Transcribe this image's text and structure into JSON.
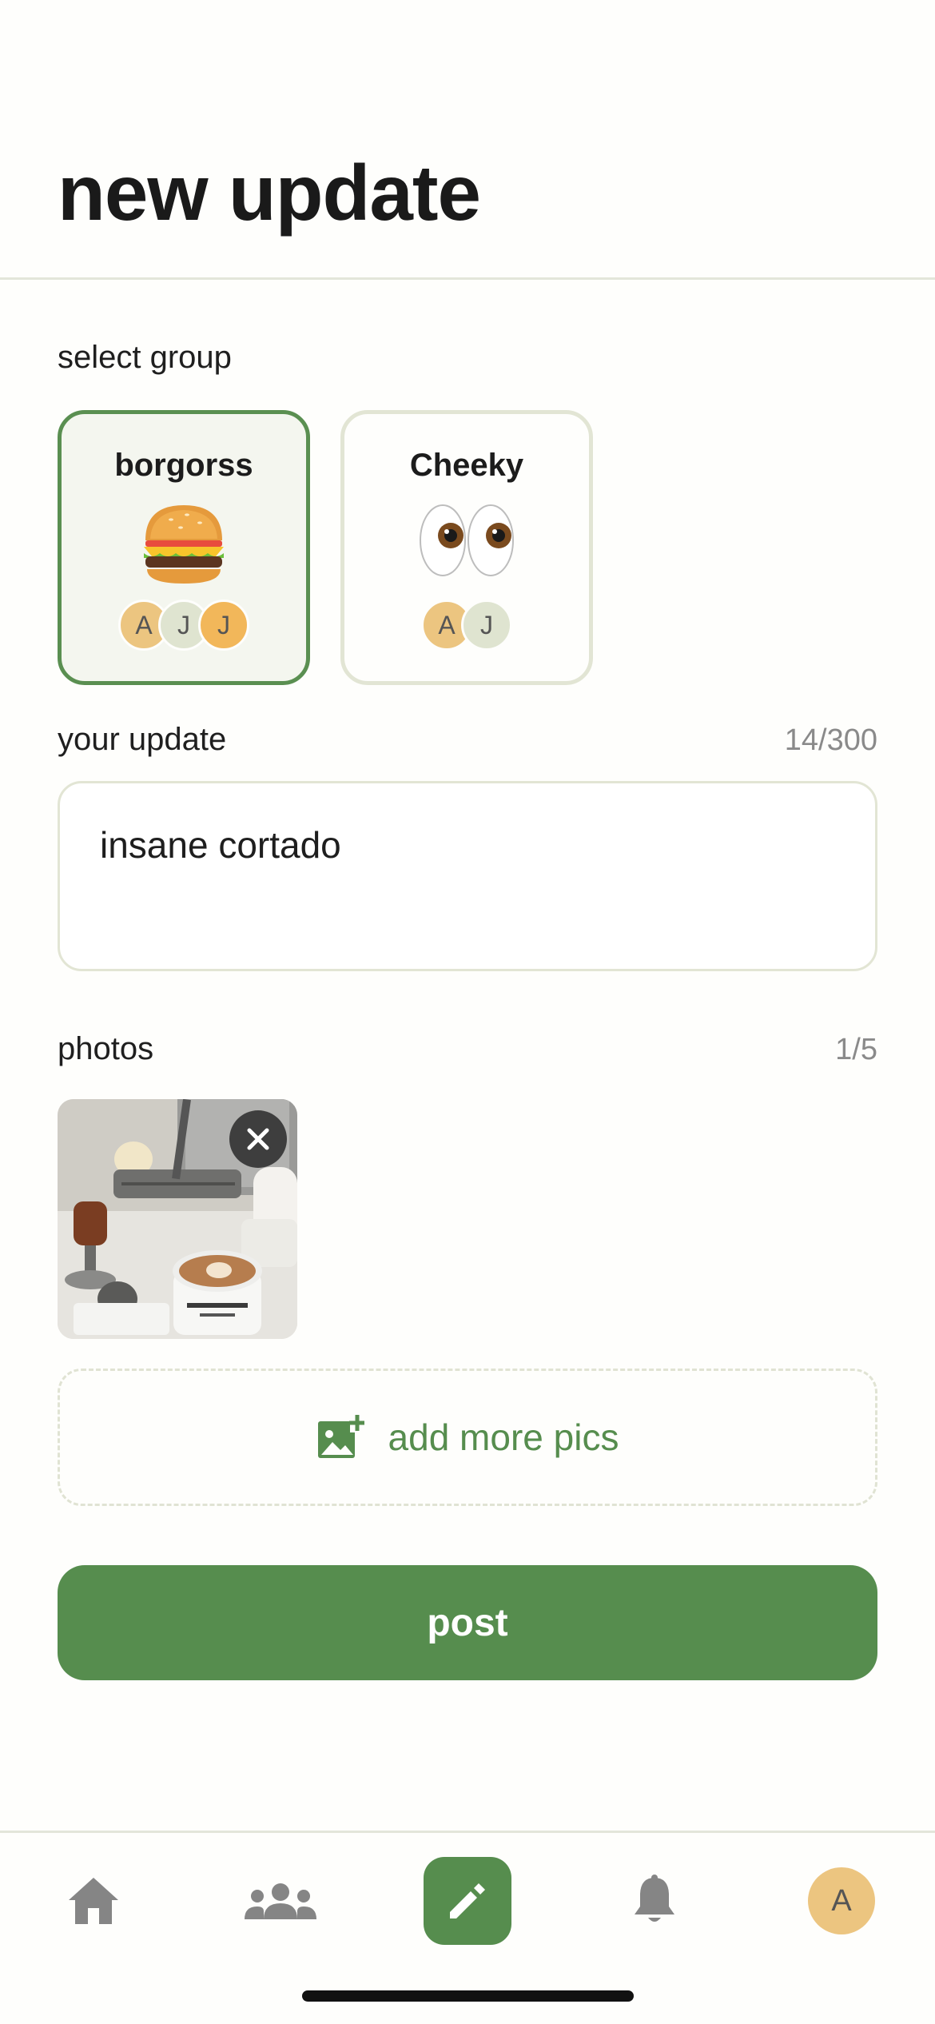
{
  "header": {
    "title": "new update"
  },
  "groups": {
    "label": "select group",
    "items": [
      {
        "name": "borgorss",
        "emoji": "burger",
        "selected": true,
        "members": [
          {
            "initial": "A",
            "color": "#ecc580"
          },
          {
            "initial": "J",
            "color": "#dfe4d0"
          },
          {
            "initial": "J",
            "color": "#f2b75a"
          }
        ]
      },
      {
        "name": "Cheeky",
        "emoji": "eyes",
        "selected": false,
        "members": [
          {
            "initial": "A",
            "color": "#ecc580"
          },
          {
            "initial": "J",
            "color": "#dfe4d0"
          }
        ]
      }
    ]
  },
  "update": {
    "label": "your update",
    "counter": "14/300",
    "value": "insane cortado"
  },
  "photos": {
    "label": "photos",
    "counter": "1/5",
    "add_more_label": "add more pics"
  },
  "post_label": "post",
  "tabbar": {
    "items": [
      "home-icon",
      "groups-icon",
      "compose-icon",
      "bell-icon",
      "profile-avatar"
    ],
    "profile_initial": "A"
  },
  "colors": {
    "accent": "#568d4e",
    "border": "#e2e5d4",
    "avatar_a": "#ecc580"
  }
}
